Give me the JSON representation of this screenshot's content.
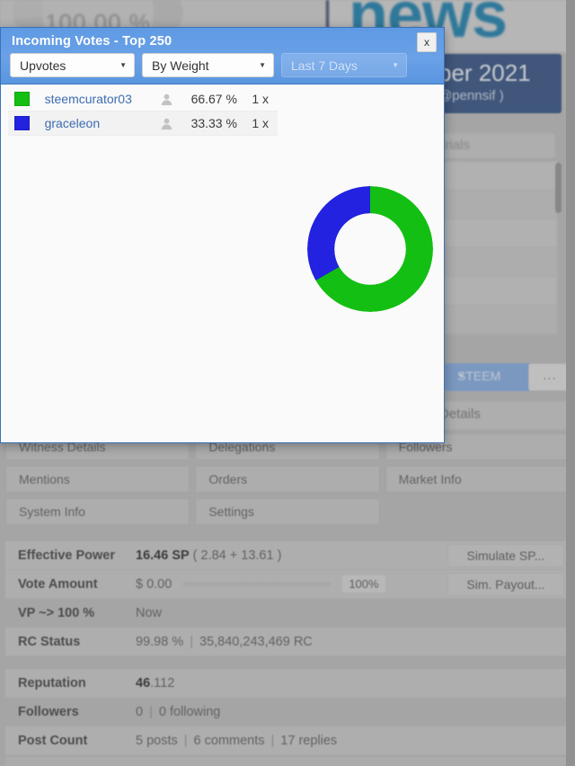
{
  "background": {
    "gauge_value": "100.00 %",
    "news_logo_text": "news",
    "date_banner_line1": "ber 2021",
    "date_banner_line2": "@pennsif )",
    "tutorials_label": "torials",
    "steem_dropdown_label": "STEEM",
    "ellipsis_button_label": "...",
    "details_button_label": "Details"
  },
  "button_grid": [
    [
      "Witness Details",
      "Delegations",
      "Followers"
    ],
    [
      "Mentions",
      "Orders",
      "Market Info"
    ],
    [
      "System Info",
      "Settings",
      ""
    ]
  ],
  "stats": [
    {
      "label": "Effective Power",
      "value_strong": "16.46 SP",
      "value_rest": "( 2.84 + 13.61 )",
      "button": "Simulate SP..."
    },
    {
      "label": "Vote Amount",
      "value_strong": "$ 0.00",
      "slider_percent": "100%",
      "button": "Sim. Payout..."
    },
    {
      "label": "VP ~> 100 %",
      "value_rest": "Now"
    },
    {
      "label": "RC Status",
      "value_rest": "99.98 %",
      "value_extra": "35,840,243,469 RC"
    },
    {
      "label": "Reputation",
      "value_strong": "46",
      "value_rest": ".112"
    },
    {
      "label": "Followers",
      "value_rest": "0",
      "value_extra": "0 following"
    },
    {
      "label": "Post Count",
      "value_rest": "5 posts",
      "value_extra": "6 comments",
      "value_extra2": "17 replies"
    }
  ],
  "modal": {
    "title": "Incoming Votes - Top 250",
    "close_label": "x",
    "filters": [
      {
        "value": "Upvotes",
        "state": "enabled"
      },
      {
        "value": "By Weight",
        "state": "enabled"
      },
      {
        "value": "Last 7 Days",
        "state": "disabled"
      }
    ],
    "rows": [
      {
        "color": "#13bf13",
        "name": "steemcurator03",
        "percent": "66.67 %",
        "count": "1 x"
      },
      {
        "color": "#2222e0",
        "name": "graceleon",
        "percent": "33.33 %",
        "count": "1 x"
      }
    ]
  },
  "chart_data": {
    "type": "pie",
    "title": "Incoming Votes - Top 250",
    "labels": [
      "steemcurator03",
      "graceleon"
    ],
    "values": [
      66.67,
      33.33
    ],
    "colors": [
      "#13bf13",
      "#2222e0"
    ],
    "unit": "%",
    "donut": true,
    "inner_radius_ratio": 0.4,
    "start_angle_deg": 0,
    "direction": "clockwise",
    "legend": "left-list"
  }
}
